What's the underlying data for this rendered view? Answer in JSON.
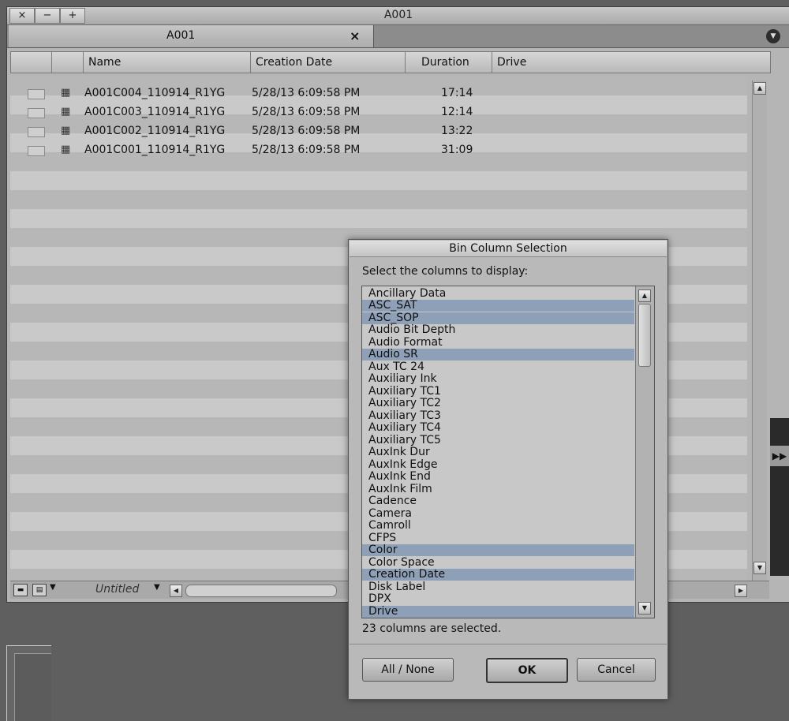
{
  "window": {
    "title": "A001",
    "tab_label": "A001",
    "tab_close_glyph": "×",
    "controls": {
      "close": "×",
      "minimize": "−",
      "zoom": "+"
    }
  },
  "bin": {
    "columns": [
      "Name",
      "Creation Date",
      "Duration",
      "Drive"
    ],
    "rows": [
      {
        "name": "A001C004_110914_R1YG",
        "creation_date": "5/28/13 6:09:58 PM",
        "duration": "17:14"
      },
      {
        "name": "A001C003_110914_R1YG",
        "creation_date": "5/28/13 6:09:58 PM",
        "duration": "12:14"
      },
      {
        "name": "A001C002_110914_R1YG",
        "creation_date": "5/28/13 6:09:58 PM",
        "duration": "13:22"
      },
      {
        "name": "A001C001_110914_R1YG",
        "creation_date": "5/28/13 6:09:58 PM",
        "duration": "31:09"
      }
    ],
    "view_name": "Untitled"
  },
  "dialog": {
    "title": "Bin Column Selection",
    "prompt": "Select the columns to display:",
    "items": [
      {
        "label": "Ancillary Data",
        "selected": false
      },
      {
        "label": "ASC_SAT",
        "selected": true
      },
      {
        "label": "ASC_SOP",
        "selected": true
      },
      {
        "label": "Audio Bit Depth",
        "selected": false
      },
      {
        "label": "Audio Format",
        "selected": false
      },
      {
        "label": "Audio SR",
        "selected": true
      },
      {
        "label": "Aux TC 24",
        "selected": false
      },
      {
        "label": "Auxiliary Ink",
        "selected": false
      },
      {
        "label": "Auxiliary TC1",
        "selected": false
      },
      {
        "label": "Auxiliary TC2",
        "selected": false
      },
      {
        "label": "Auxiliary TC3",
        "selected": false
      },
      {
        "label": "Auxiliary TC4",
        "selected": false
      },
      {
        "label": "Auxiliary TC5",
        "selected": false
      },
      {
        "label": "AuxInk Dur",
        "selected": false
      },
      {
        "label": "AuxInk Edge",
        "selected": false
      },
      {
        "label": "AuxInk End",
        "selected": false
      },
      {
        "label": "AuxInk Film",
        "selected": false
      },
      {
        "label": "Cadence",
        "selected": false
      },
      {
        "label": "Camera",
        "selected": false
      },
      {
        "label": "Camroll",
        "selected": false
      },
      {
        "label": "CFPS",
        "selected": false
      },
      {
        "label": "Color",
        "selected": true
      },
      {
        "label": "Color Space",
        "selected": false
      },
      {
        "label": "Creation Date",
        "selected": true
      },
      {
        "label": "Disk Label",
        "selected": false
      },
      {
        "label": "DPX",
        "selected": false
      },
      {
        "label": "Drive",
        "selected": true
      }
    ],
    "status": "23 columns are selected.",
    "buttons": {
      "all_none": "All / None",
      "ok": "OK",
      "cancel": "Cancel"
    },
    "highlight_color": "#8ea0b7"
  }
}
